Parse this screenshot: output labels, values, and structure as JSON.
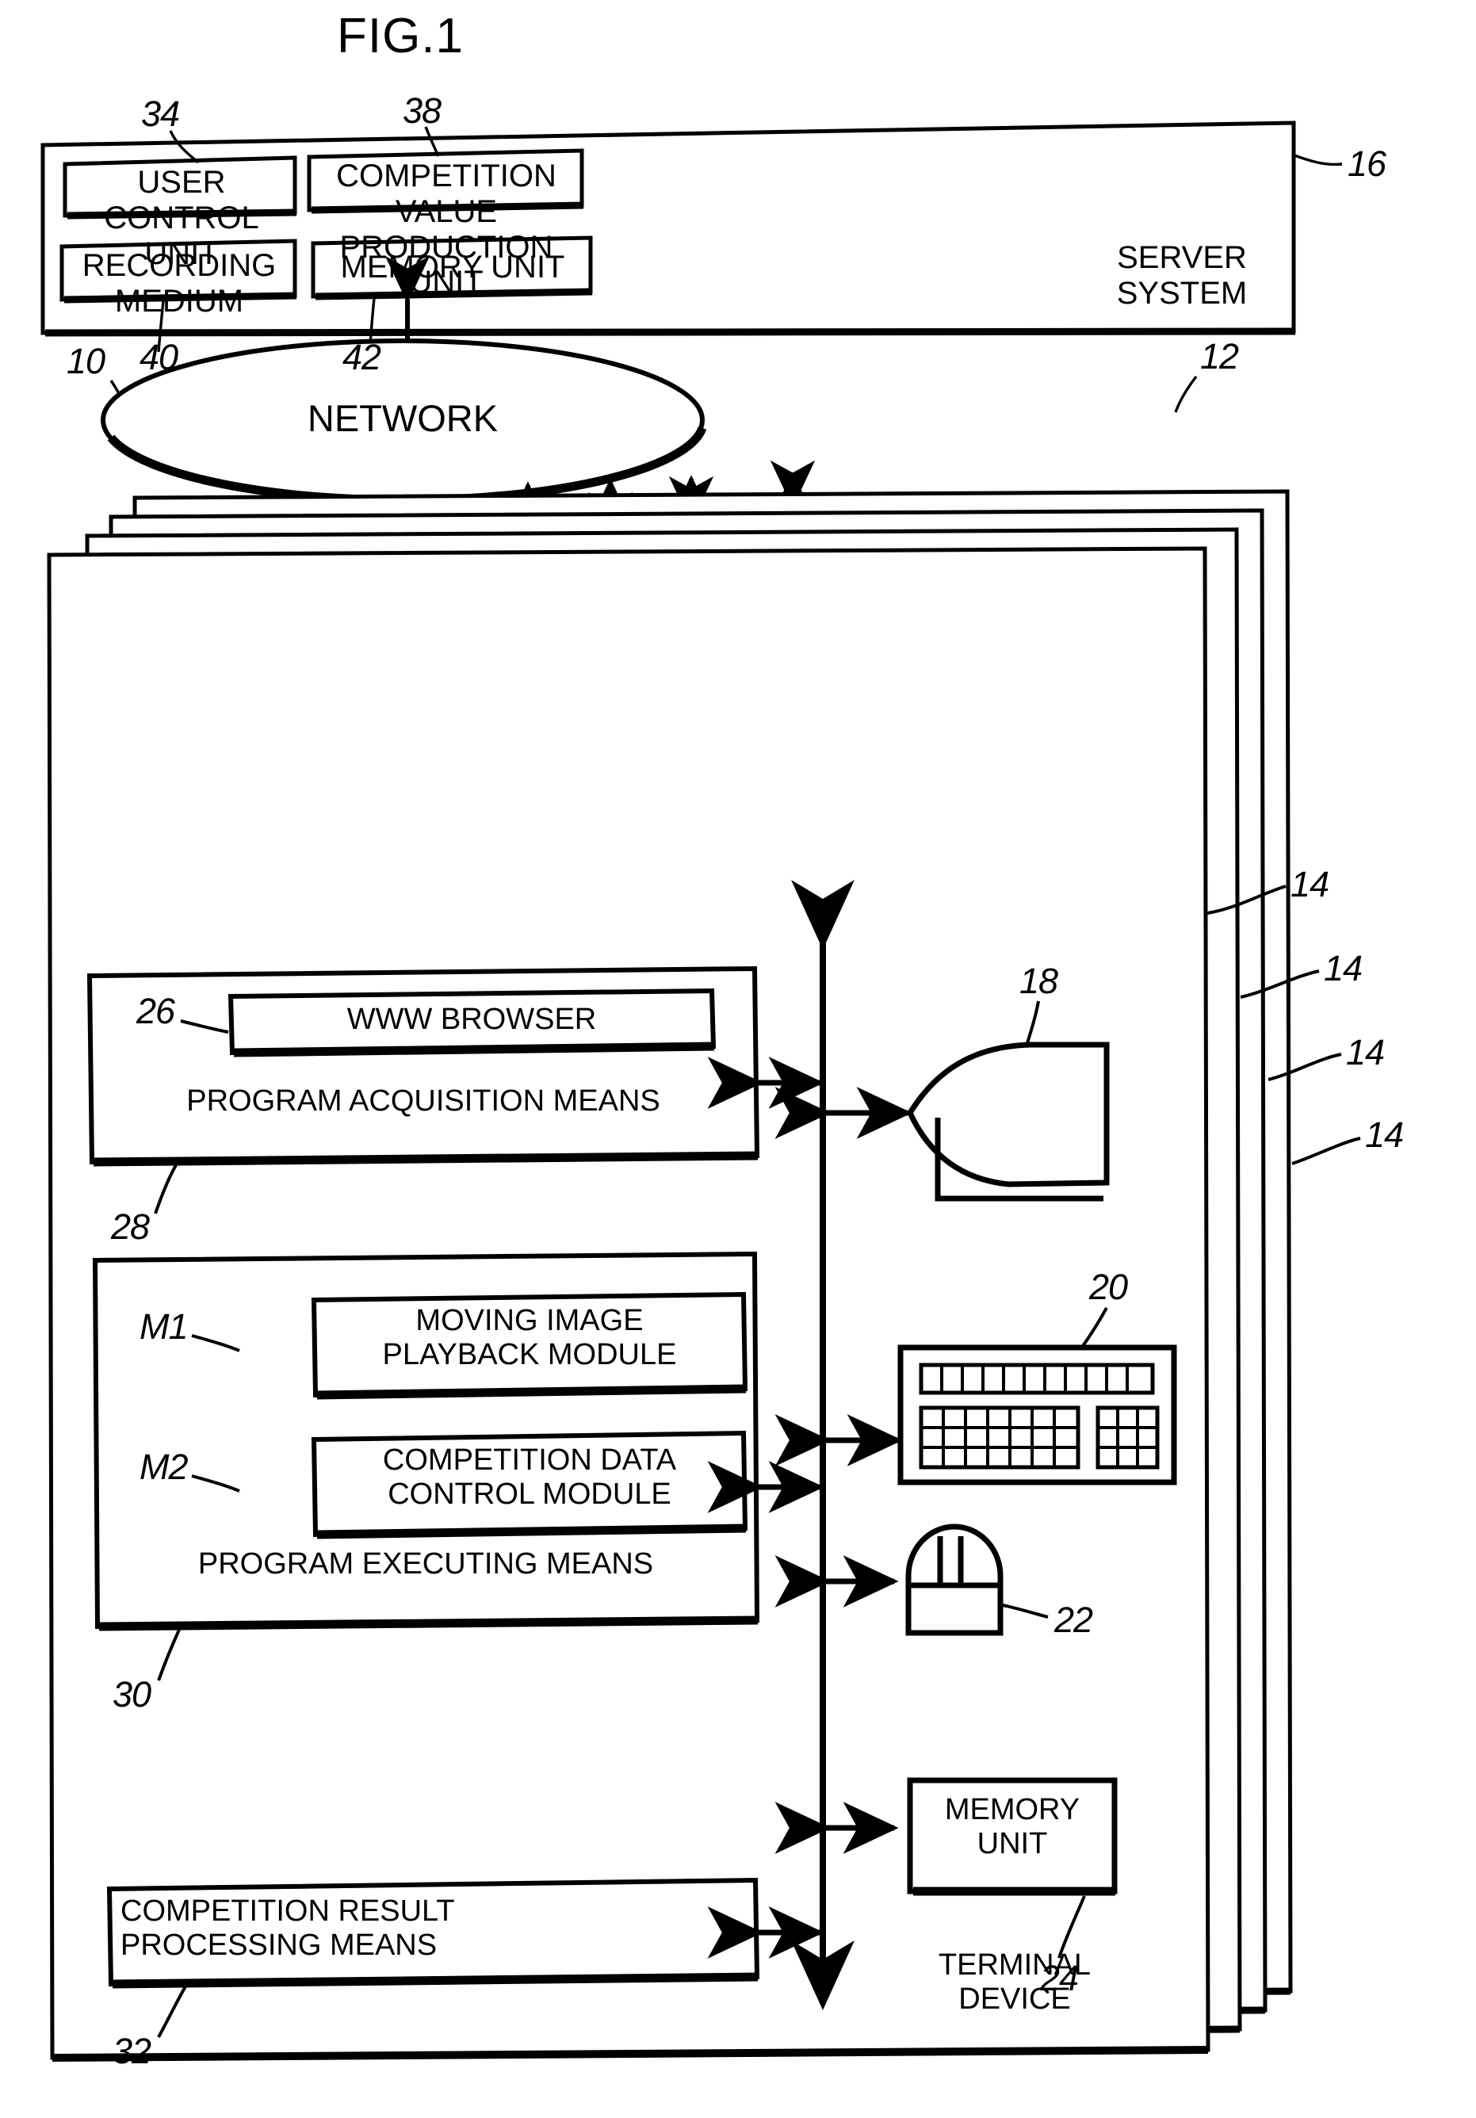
{
  "figure": {
    "title": "FIG.1"
  },
  "server_system": {
    "label": "SERVER\nSYSTEM",
    "ref": "16",
    "blocks": [
      {
        "label": "USER\nCONTROL UNIT",
        "ref": "34"
      },
      {
        "label": "COMPETITION VALUE\nPRODUCTION UNIT",
        "ref": "38"
      },
      {
        "label": "RECORDING\nMEDIUM",
        "ref": "40"
      },
      {
        "label": "MEMORY UNIT",
        "ref": "42"
      }
    ]
  },
  "system_ref": "10",
  "network": {
    "label": "NETWORK",
    "ref": "12"
  },
  "terminal": {
    "label": "TERMINAL\nDEVICE",
    "refs": [
      "14",
      "14",
      "14",
      "14"
    ],
    "program_acquisition": {
      "label": "PROGRAM ACQUISITION MEANS",
      "ref": "28",
      "inner": {
        "label": "WWW BROWSER",
        "ref": "26"
      }
    },
    "program_executing": {
      "label": "PROGRAM EXECUTING MEANS",
      "ref": "30",
      "modules": [
        {
          "label": "MOVING IMAGE\nPLAYBACK MODULE",
          "ref": "M1"
        },
        {
          "label": "COMPETITION DATA\nCONTROL MODULE",
          "ref": "M2"
        }
      ]
    },
    "competition_result": {
      "label": "COMPETITION RESULT\nPROCESSING MEANS",
      "ref": "32"
    },
    "peripherals": [
      {
        "name": "display",
        "ref": "18"
      },
      {
        "name": "keyboard",
        "ref": "20"
      },
      {
        "name": "mouse",
        "ref": "22"
      },
      {
        "name": "memory-unit",
        "label": "MEMORY\nUNIT",
        "ref": "24"
      }
    ]
  },
  "colors": {
    "ink": "#000000",
    "paper": "#ffffff"
  }
}
